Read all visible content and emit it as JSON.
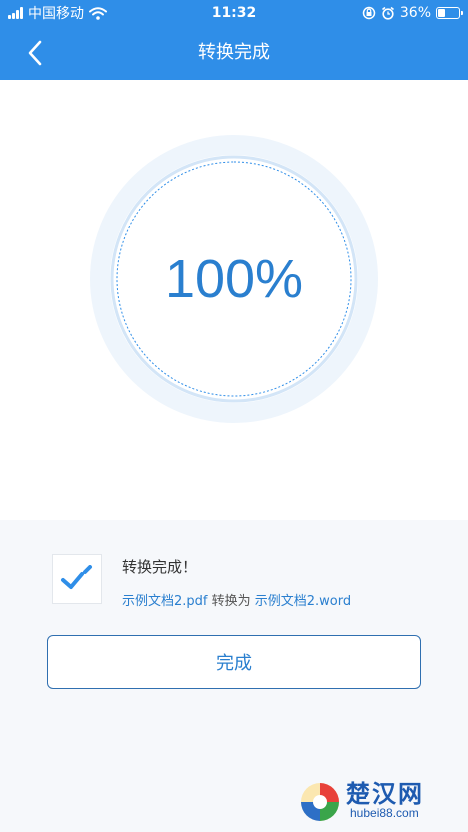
{
  "status_bar": {
    "carrier": "中国移动",
    "time": "11:32",
    "battery_percent": "36%",
    "battery_level": 0.36,
    "icons": [
      "signal-bars-icon",
      "wifi-icon",
      "orientation-lock-icon",
      "alarm-icon",
      "battery-icon"
    ]
  },
  "header": {
    "title": "转换完成",
    "back_icon": "chevron-left-icon"
  },
  "progress": {
    "label": "100%",
    "value": 1.0
  },
  "result": {
    "title": "转换完成！",
    "source_file": "示例文档2.pdf",
    "connector": " 转换为 ",
    "target_file": "示例文档2.word",
    "icon": "document-check-icon"
  },
  "actions": {
    "done_label": "完成"
  },
  "watermark": {
    "brand": "楚汉网",
    "url": "hubei88.com"
  },
  "colors": {
    "primary": "#2f8ee8",
    "accent_text": "#2a7fcf",
    "ring_light": "#eef5fc",
    "ring_line": "#d3e5f7",
    "panel_bg": "#f6f8fb",
    "button_border": "#2f6fb0"
  }
}
